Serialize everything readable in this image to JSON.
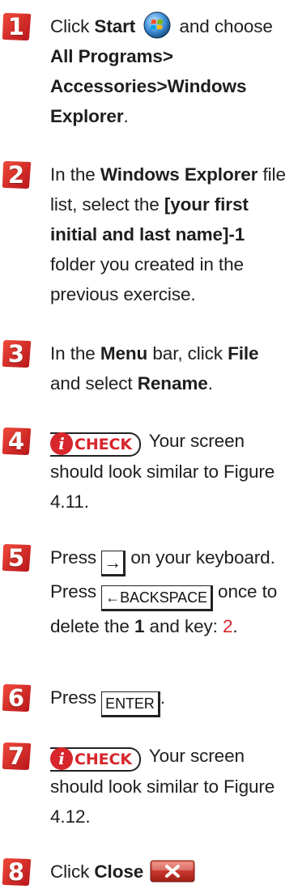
{
  "steps": [
    {
      "number": "1",
      "parts": [
        "Click ",
        "Start",
        " and choose ",
        "All Programs> Accessories>Windows Explorer",
        "."
      ]
    },
    {
      "number": "2",
      "parts": [
        "In the ",
        "Windows Explorer",
        " file list, select the ",
        "[your first initial and last name]-1",
        " folder you created in the previous exercise."
      ]
    },
    {
      "number": "3",
      "parts": [
        "In the ",
        "Menu",
        " bar, click ",
        "File",
        " and select ",
        "Rename",
        "."
      ]
    },
    {
      "number": "4",
      "check_label": "CHECK",
      "check_letter": "i",
      "parts": [
        " Your screen should look similar to Figure 4.11."
      ]
    },
    {
      "number": "5",
      "parts": [
        "Press ",
        " on your keyboard. Press ",
        " once to delete the ",
        "1",
        " and key: ",
        "2",
        "."
      ],
      "keys": {
        "arrow": "→",
        "backspace": "←BACKSPACE"
      }
    },
    {
      "number": "6",
      "parts": [
        "Press ",
        "."
      ],
      "keys": {
        "enter": "ENTER"
      }
    },
    {
      "number": "7",
      "check_label": "CHECK",
      "check_letter": "i",
      "parts": [
        " Your screen should look similar to Figure 4.12."
      ]
    },
    {
      "number": "8",
      "parts": [
        "Click ",
        "Close",
        " "
      ]
    }
  ],
  "colors": {
    "badge_red": "#d7262c",
    "text": "#1e1e1e",
    "close_red": "#c8372d"
  }
}
